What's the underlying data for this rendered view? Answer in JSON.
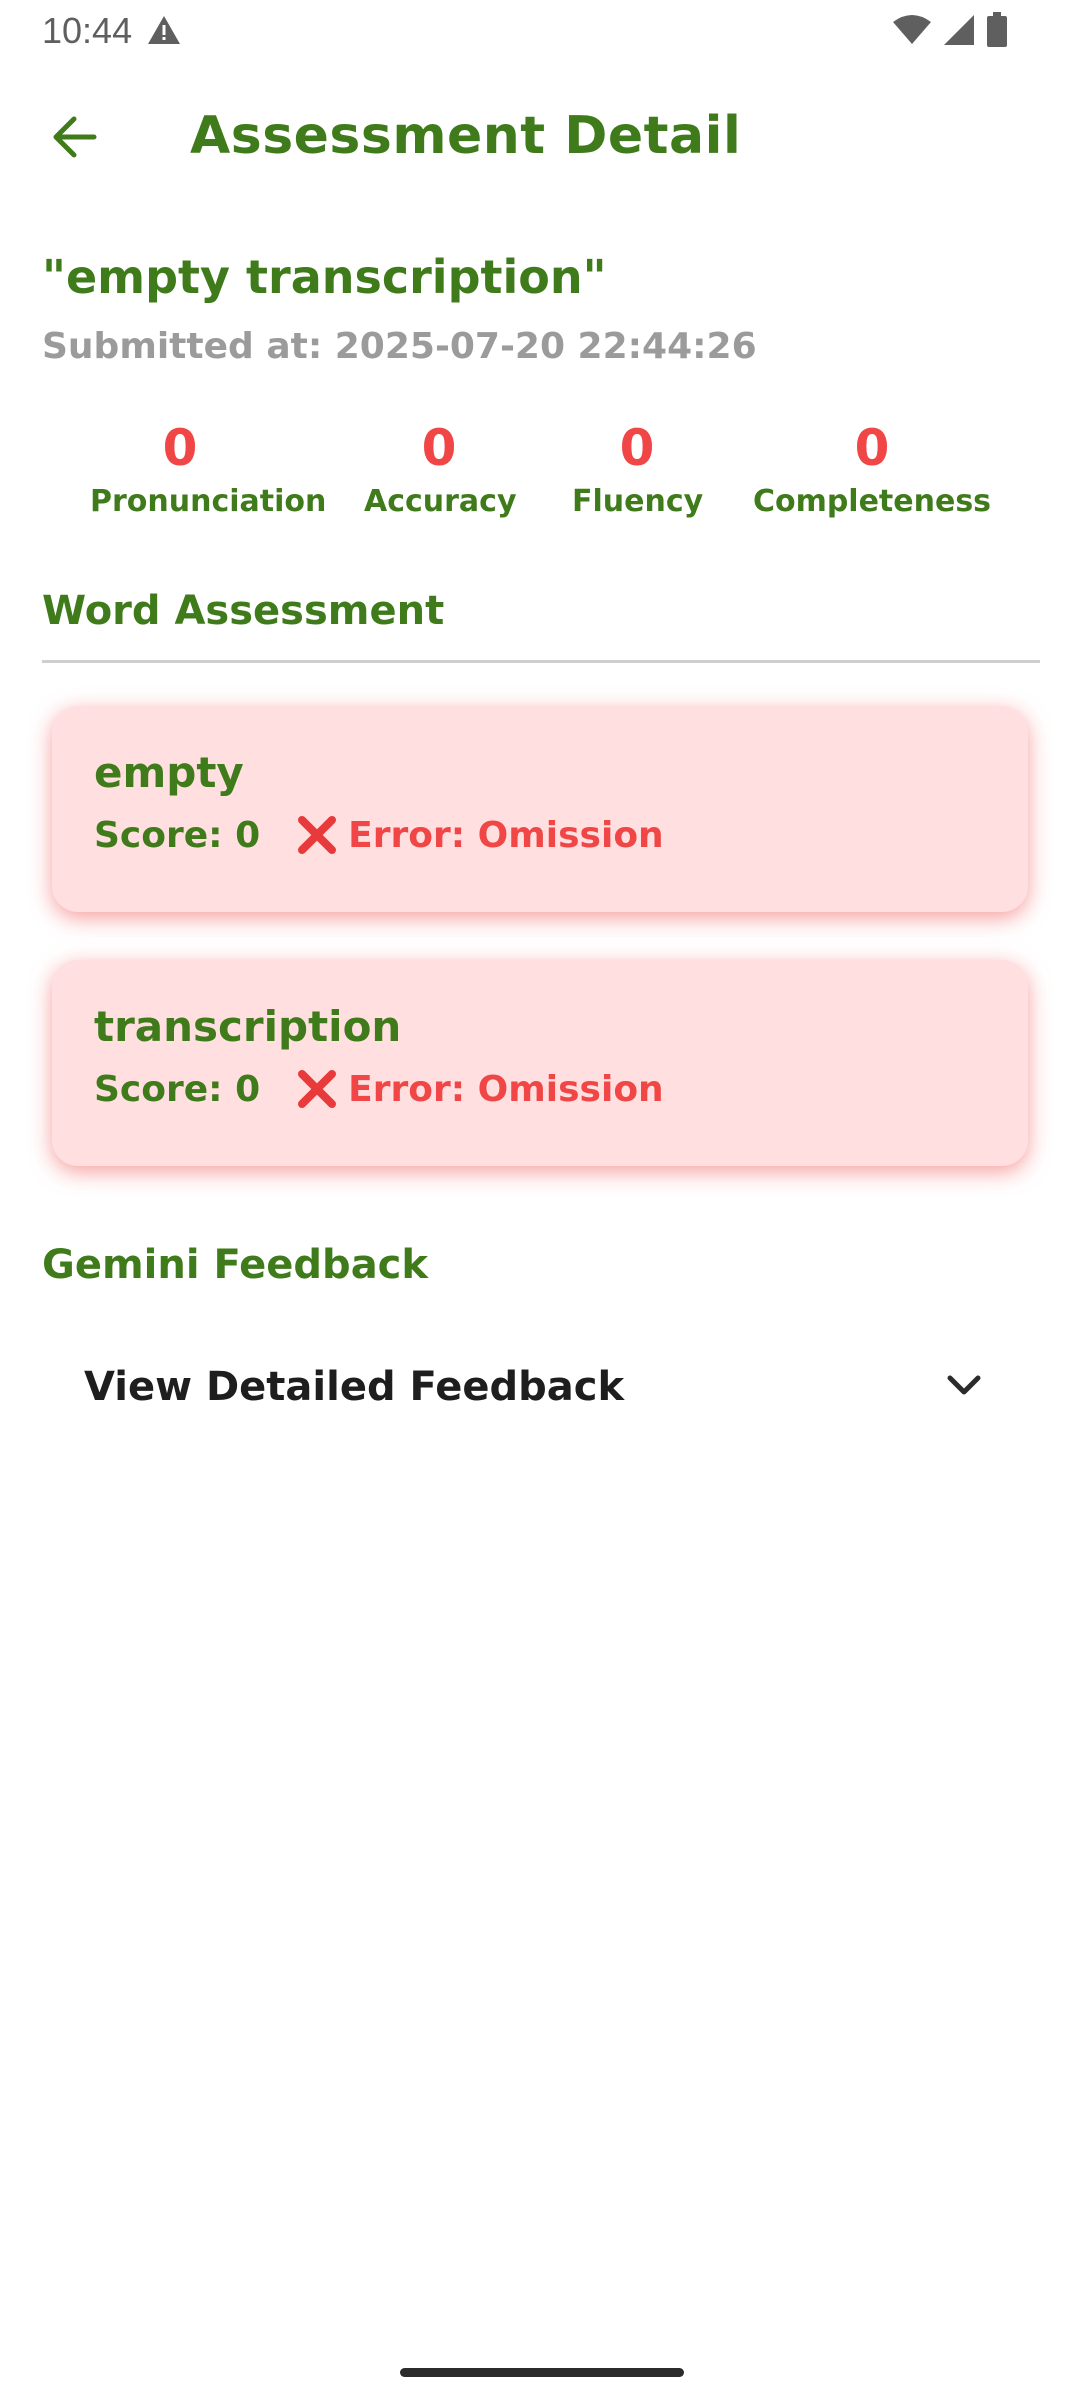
{
  "status_bar": {
    "time": "10:44",
    "icons": [
      "alert-triangle-icon",
      "wifi-icon",
      "cell-signal-icon",
      "battery-icon"
    ]
  },
  "app_bar": {
    "title": "Assessment Detail",
    "back_icon": "arrow-back-icon"
  },
  "assessment": {
    "title": "\"empty transcription\"",
    "submitted_at": "Submitted at: 2025-07-20 22:44:26"
  },
  "scores": [
    {
      "value": "0",
      "label": "Pronunciation"
    },
    {
      "value": "0",
      "label": "Accuracy"
    },
    {
      "value": "0",
      "label": "Fluency"
    },
    {
      "value": "0",
      "label": "Completeness"
    }
  ],
  "word_section": {
    "title": "Word Assessment",
    "words": [
      {
        "word": "empty",
        "score": "Score: 0",
        "error": "Error: Omission",
        "error_icon": "cross-mark-icon"
      },
      {
        "word": "transcription",
        "score": "Score: 0",
        "error": "Error: Omission",
        "error_icon": "cross-mark-icon"
      }
    ]
  },
  "feedback_section": {
    "title": "Gemini Feedback",
    "toggle_label": "View Detailed Feedback",
    "toggle_icon": "chevron-down-icon"
  },
  "colors": {
    "primary_green": "#3f7b1b",
    "score_red": "#f04646",
    "card_background": "#ffdfe0",
    "muted_gray": "#9b9b9b"
  }
}
